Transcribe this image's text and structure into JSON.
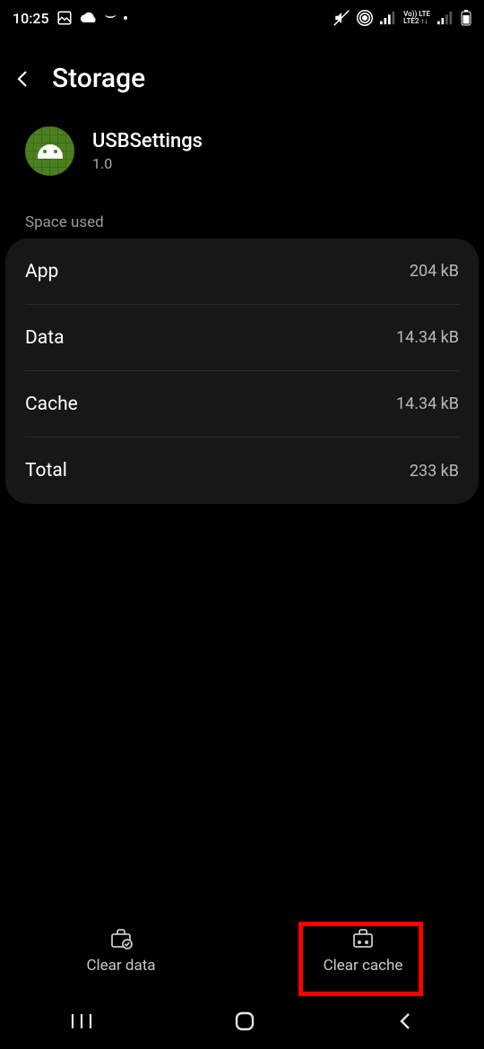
{
  "statusbar": {
    "time": "10:25"
  },
  "header": {
    "title": "Storage"
  },
  "app": {
    "name": "USBSettings",
    "version": "1.0"
  },
  "section": {
    "space_used": "Space used"
  },
  "rows": {
    "app": {
      "label": "App",
      "value": "204 kB"
    },
    "data": {
      "label": "Data",
      "value": "14.34 kB"
    },
    "cache": {
      "label": "Cache",
      "value": "14.34 kB"
    },
    "total": {
      "label": "Total",
      "value": "233 kB"
    }
  },
  "actions": {
    "clear_data": "Clear data",
    "clear_cache": "Clear cache"
  }
}
